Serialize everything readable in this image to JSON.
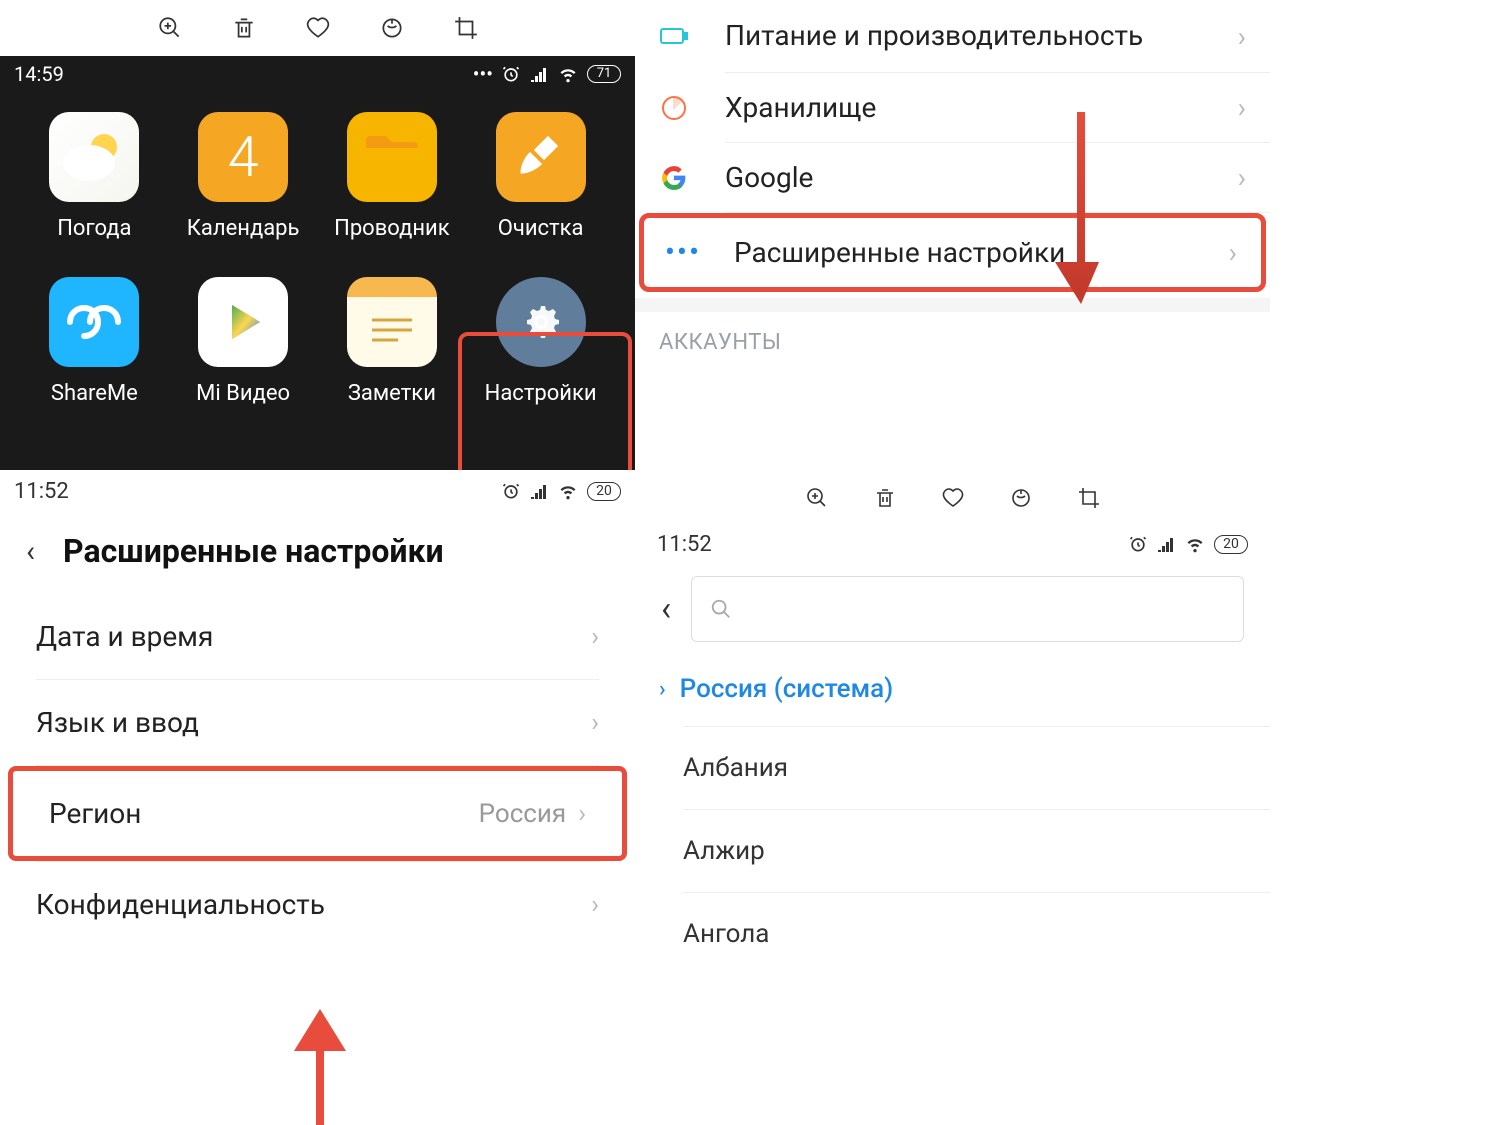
{
  "panel1": {
    "time": "14:59",
    "battery": "71",
    "apps": [
      {
        "label": "Погода",
        "name": "weather"
      },
      {
        "label": "Календарь",
        "name": "calendar",
        "digit": "4"
      },
      {
        "label": "Проводник",
        "name": "files"
      },
      {
        "label": "Очистка",
        "name": "cleaner"
      },
      {
        "label": "ShareMe",
        "name": "shareme"
      },
      {
        "label": "Mi Видео",
        "name": "mivideo"
      },
      {
        "label": "Заметки",
        "name": "notes"
      },
      {
        "label": "Настройки",
        "name": "settings"
      }
    ]
  },
  "panel2": {
    "rows": [
      {
        "label": "Питание и производительность",
        "icon": "battery"
      },
      {
        "label": "Хранилище",
        "icon": "pie"
      },
      {
        "label": "Google",
        "icon": "google"
      },
      {
        "label": "Расширенные настройки",
        "icon": "dots",
        "highlight": true
      }
    ],
    "section": "АККАУНТЫ"
  },
  "panel3": {
    "time": "11:52",
    "battery": "20",
    "title": "Расширенные настройки",
    "rows": [
      {
        "label": "Дата и время"
      },
      {
        "label": "Язык и ввод"
      },
      {
        "label": "Регион",
        "value": "Россия",
        "highlight": true
      },
      {
        "label": "Конфиденциальность"
      }
    ]
  },
  "panel4": {
    "time": "11:52",
    "battery": "20",
    "current": "Россия (система)",
    "regions": [
      "Албания",
      "Алжир",
      "Ангола"
    ]
  }
}
